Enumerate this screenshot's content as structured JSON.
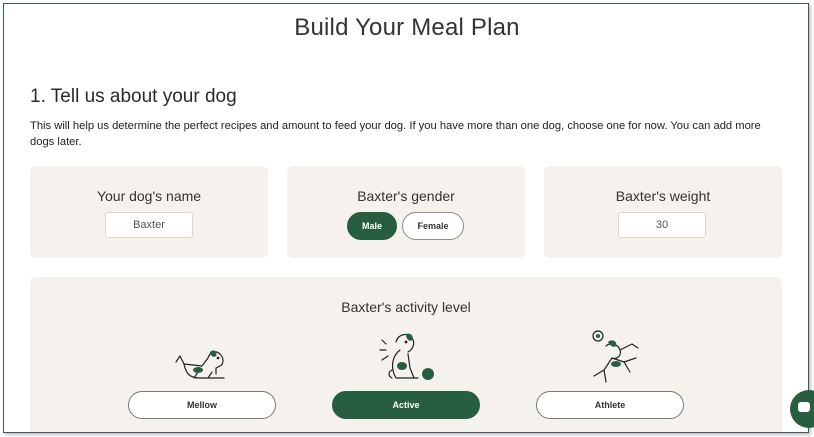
{
  "header": {
    "title": "Build Your Meal Plan"
  },
  "section": {
    "title": "1. Tell us about your dog",
    "intro": "This will help us determine the perfect recipes and amount to feed your dog. If you have more than one dog, choose one for now. You can add more dogs later."
  },
  "name_card": {
    "label": "Your dog's name",
    "value": "Baxter"
  },
  "gender_card": {
    "label": "Baxter's gender",
    "options": [
      "Male",
      "Female"
    ],
    "selected": "Male"
  },
  "weight_card": {
    "label": "Baxter's weight",
    "value": "30"
  },
  "activity": {
    "label": "Baxter's activity level",
    "options": [
      {
        "label": "Mellow",
        "icon": "lying-dog-icon"
      },
      {
        "label": "Active",
        "icon": "sitting-dog-with-ball-icon"
      },
      {
        "label": "Athlete",
        "icon": "jumping-dog-icon"
      }
    ],
    "selected": "Active"
  },
  "colors": {
    "accent": "#275e40",
    "card_bg": "#f5f1ec"
  },
  "chat": {
    "icon": "chat-icon"
  }
}
